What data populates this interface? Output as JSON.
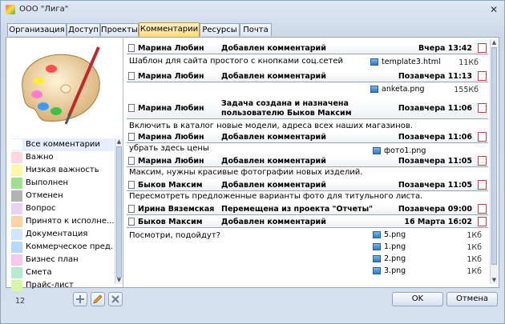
{
  "window": {
    "title": "ООО \"Лига\"",
    "close_glyph": "✕"
  },
  "tabs": [
    {
      "label": "Организация"
    },
    {
      "label": "Доступ"
    },
    {
      "label": "Проекты"
    },
    {
      "label": "Комментарии",
      "active": true
    },
    {
      "label": "Ресурсы"
    },
    {
      "label": "Почта"
    }
  ],
  "categories": [
    {
      "label": "Все комментарии",
      "color": "#ffffff"
    },
    {
      "label": "Важно",
      "color": "#ffd6dc"
    },
    {
      "label": "Низкая важность",
      "color": "#fff7a8"
    },
    {
      "label": "Выполнен",
      "color": "#9fe08c"
    },
    {
      "label": "Отменен",
      "color": "#b3b3b3"
    },
    {
      "label": "Вопрос",
      "color": "#e8d2f2"
    },
    {
      "label": "Принято к исполне...",
      "color": "#ffd2a6"
    },
    {
      "label": "Документация",
      "color": "#cfe6fb"
    },
    {
      "label": "Коммерческое пред...",
      "color": "#b7d8fb"
    },
    {
      "label": "Бизнес план",
      "color": "#f7c7ee"
    },
    {
      "label": "Смета",
      "color": "#b5ead0"
    },
    {
      "label": "Прайс-лист",
      "color": "#d7f5a8"
    }
  ],
  "feed": [
    {
      "author": "Марина Любин",
      "action": "Добавлен комментарий",
      "time": "Вчера 13:42",
      "text": "Шаблон для сайта простого с кнопками соц.сетей",
      "files": [
        {
          "name": "template3.html",
          "size": "11Кб"
        }
      ]
    },
    {
      "author": "Марина Любин",
      "action": "Добавлен комментарий",
      "time": "Позавчера 11:13",
      "text": "",
      "files": [
        {
          "name": "anketa.png",
          "size": "155Кб"
        }
      ]
    },
    {
      "author": "Марина Любин",
      "action": "Задача создана и назначена",
      "action2": "пользователю Быков Максим",
      "time": "Позавчера 11:06",
      "text": "Включить в каталог новые модели, адреса всех наших магазинов.",
      "files": []
    },
    {
      "author": "Марина Любин",
      "action": "Добавлен комментарий",
      "time": "Позавчера 11:06",
      "text": "убрать здесь цены",
      "files": [
        {
          "name": "фото1.png",
          "size": ""
        }
      ]
    },
    {
      "author": "Марина Любин",
      "action": "Добавлен комментарий",
      "time": "Позавчера 11:05",
      "text": "Максим, нужны красивые фотографии новых изделий.",
      "files": []
    },
    {
      "author": "Быков Максим",
      "action": "Добавлен комментарий",
      "time": "Позавчера 11:05",
      "text": "Пересмотреть предложенные варианты фото для титульного листа.",
      "files": []
    },
    {
      "author": "Ирина Вяземская",
      "action": "Перемещена из проекта \"Отчеты\"",
      "time": "Позавчера 09:00",
      "text": "",
      "files": []
    },
    {
      "author": "Быков Максим",
      "action": "Добавлен комментарий",
      "time": "16 Марта 16:02",
      "text": "Посмотри, подойдут?",
      "files": [
        {
          "name": "5.png",
          "size": "1Кб"
        },
        {
          "name": "1.png",
          "size": "1Кб"
        },
        {
          "name": "2.png",
          "size": "1Кб"
        },
        {
          "name": "3.png",
          "size": "1Кб"
        }
      ]
    }
  ],
  "footer": {
    "count": "12",
    "ok_label": "OK",
    "cancel_label": "Отмена"
  },
  "colors": {
    "active_tab": "#ffd979",
    "accent_border": "#8ea4c1"
  }
}
